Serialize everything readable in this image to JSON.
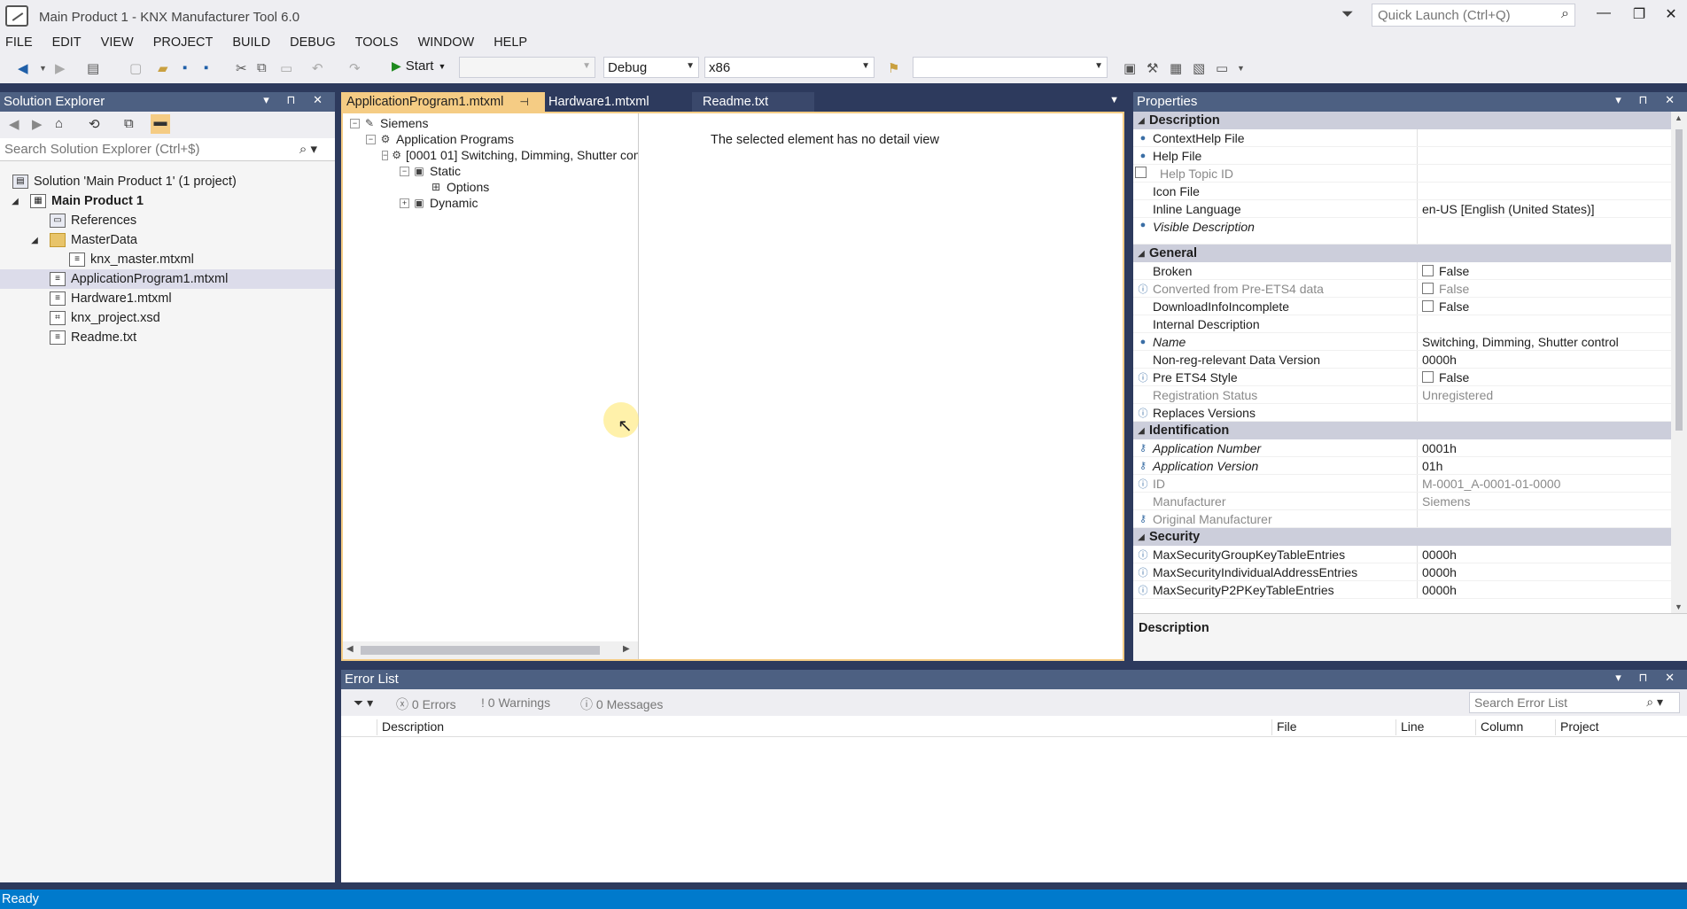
{
  "window": {
    "title": "Main Product 1 - KNX Manufacturer Tool 6.0",
    "quick_launch_placeholder": "Quick Launch (Ctrl+Q)"
  },
  "menu": [
    "FILE",
    "EDIT",
    "VIEW",
    "PROJECT",
    "BUILD",
    "DEBUG",
    "TOOLS",
    "WINDOW",
    "HELP"
  ],
  "toolbar": {
    "start_label": "Start",
    "config_value": "Debug",
    "platform_value": "x86"
  },
  "solution_explorer": {
    "title": "Solution Explorer",
    "search_placeholder": "Search Solution Explorer (Ctrl+$)",
    "items": [
      {
        "label": "Solution 'Main Product 1' (1 project)"
      },
      {
        "label": "Main Product 1"
      },
      {
        "label": "References"
      },
      {
        "label": "MasterData"
      },
      {
        "label": "knx_master.mtxml"
      },
      {
        "label": "ApplicationProgram1.mtxml"
      },
      {
        "label": "Hardware1.mtxml"
      },
      {
        "label": "knx_project.xsd"
      },
      {
        "label": "Readme.txt"
      }
    ]
  },
  "editor": {
    "tabs": [
      {
        "label": "ApplicationProgram1.mtxml"
      },
      {
        "label": "Hardware1.mtxml"
      },
      {
        "label": "Readme.txt"
      }
    ],
    "tree": [
      {
        "label": "Siemens"
      },
      {
        "label": "Application Programs"
      },
      {
        "label": "[0001 01] Switching, Dimming, Shutter cont"
      },
      {
        "label": "Static"
      },
      {
        "label": "Options"
      },
      {
        "label": "Dynamic"
      }
    ],
    "detail_message": "The selected element has no detail view"
  },
  "properties": {
    "title": "Properties",
    "categories": [
      {
        "name": "Description",
        "rows": [
          {
            "name": "ContextHelp File",
            "value": ""
          },
          {
            "name": "Help File",
            "value": ""
          },
          {
            "name": "Help Topic ID",
            "value": ""
          },
          {
            "name": "Icon File",
            "value": ""
          },
          {
            "name": "Inline Language",
            "value": "en-US [English (United States)]"
          },
          {
            "name": "Visible Description",
            "value": ""
          }
        ]
      },
      {
        "name": "General",
        "rows": [
          {
            "name": "Broken",
            "value": "False"
          },
          {
            "name": "Converted from Pre-ETS4 data",
            "value": "False"
          },
          {
            "name": "DownloadInfoIncomplete",
            "value": "False"
          },
          {
            "name": "Internal Description",
            "value": ""
          },
          {
            "name": "Name",
            "value": "Switching, Dimming, Shutter control"
          },
          {
            "name": "Non-reg-relevant Data Version",
            "value": "0000h"
          },
          {
            "name": "Pre ETS4 Style",
            "value": "False"
          },
          {
            "name": "Registration Status",
            "value": "Unregistered"
          },
          {
            "name": "Replaces Versions",
            "value": ""
          }
        ]
      },
      {
        "name": "Identification",
        "rows": [
          {
            "name": "Application Number",
            "value": "0001h"
          },
          {
            "name": "Application Version",
            "value": "01h"
          },
          {
            "name": "ID",
            "value": "M-0001_A-0001-01-0000"
          },
          {
            "name": "Manufacturer",
            "value": "Siemens"
          },
          {
            "name": "Original Manufacturer",
            "value": ""
          }
        ]
      },
      {
        "name": "Security",
        "rows": [
          {
            "name": "MaxSecurityGroupKeyTableEntries",
            "value": "0000h"
          },
          {
            "name": "MaxSecurityIndividualAddressEntries",
            "value": "0000h"
          },
          {
            "name": "MaxSecurityP2PKeyTableEntries",
            "value": "0000h"
          }
        ]
      }
    ],
    "description_label": "Description"
  },
  "error_list": {
    "title": "Error List",
    "errors": "0 Errors",
    "warnings": "0 Warnings",
    "messages": "0 Messages",
    "search_placeholder": "Search Error List",
    "columns": [
      "Description",
      "File",
      "Line",
      "Column",
      "Project"
    ]
  },
  "status": "Ready"
}
